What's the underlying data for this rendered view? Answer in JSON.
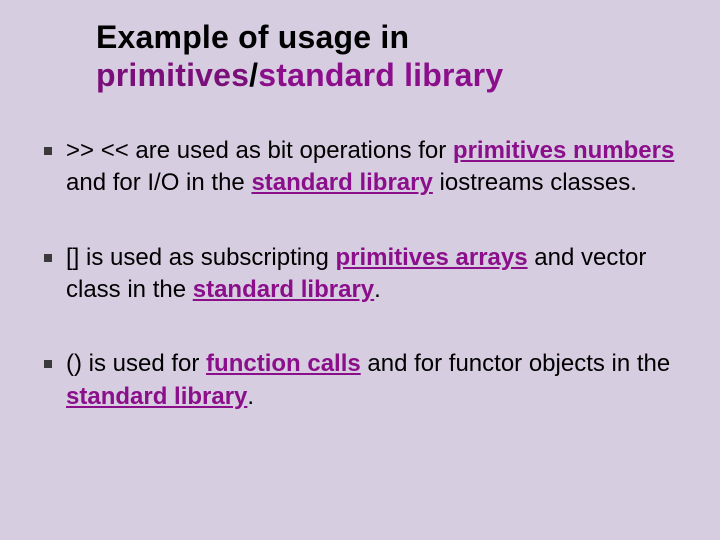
{
  "title": {
    "part1": "Example of usage in ",
    "primitives": "primitives",
    "slash": "/",
    "stdlib": "standard library"
  },
  "bullets": [
    {
      "t1": ">> << are used as bit operations for ",
      "s1": "primitives numbers",
      "t2": " and for I/O in the ",
      "s2": "standard library",
      "t3": " iostreams classes."
    },
    {
      "t1": "[] is used as subscripting ",
      "s1": "primitives arrays",
      "t2": " and vector class in the ",
      "s2": "standard library",
      "t3": "."
    },
    {
      "t1": "() is used for ",
      "s1": "function calls",
      "t2": " and for functor objects in the ",
      "s2": "standard library",
      "t3": "."
    }
  ]
}
